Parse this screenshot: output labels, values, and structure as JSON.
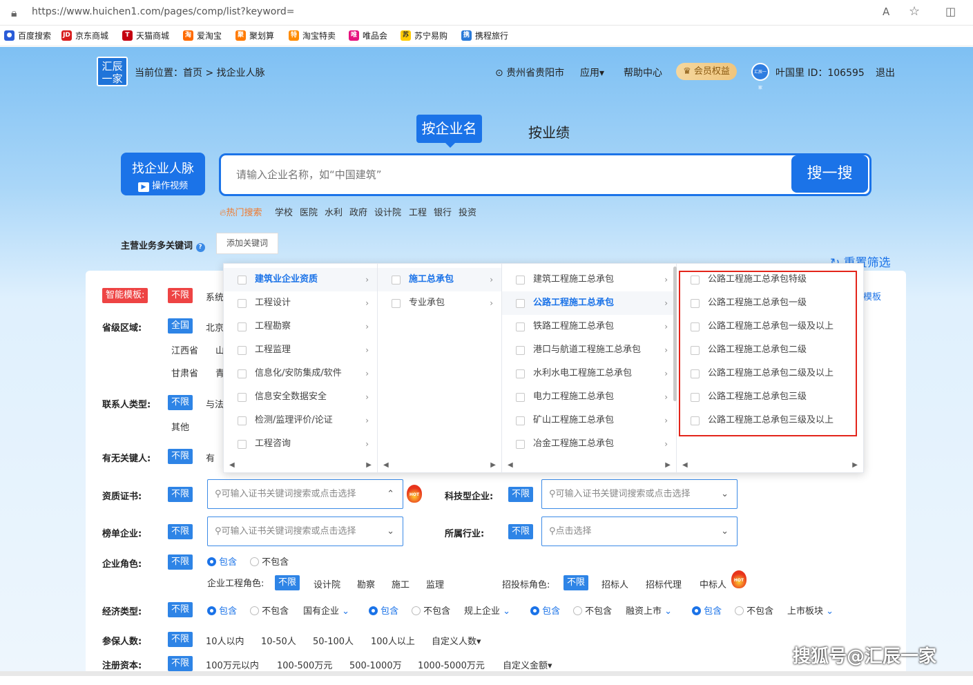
{
  "browser": {
    "url": "https://www.huichen1.com/pages/comp/list?keyword=",
    "read_icon": "A̅",
    "star_icon": "☆"
  },
  "bookmarks": [
    "百度搜索",
    "京东商城",
    "天猫商城",
    "爱淘宝",
    "聚划算",
    "淘宝特卖",
    "唯品会",
    "苏宁易购",
    "携程旅行"
  ],
  "header": {
    "logo_line1": "汇辰",
    "logo_line2": "一家",
    "breadcrumb": "当前位置：首页 > 找企业人脉",
    "location": "贵州省贵阳市",
    "apps": "应用▾",
    "help": "帮助中心",
    "vip": "会员权益",
    "user": "叶国里 ID：106595",
    "logout": "退出",
    "avatar_text": "汇辰一家"
  },
  "tabs": {
    "by_name": "按企业名",
    "by_perf": "按业绩"
  },
  "find": {
    "title": "找企业人脉",
    "video": "操作视频"
  },
  "search": {
    "placeholder": "请输入企业名称，如“中国建筑”",
    "button": "搜一搜"
  },
  "hot": {
    "label": "热门搜索",
    "items": [
      "学校",
      "医院",
      "水利",
      "政府",
      "设计院",
      "工程",
      "银行",
      "投资"
    ]
  },
  "keyword": {
    "label": "主营业务多关键词",
    "button": "添加关键词"
  },
  "reset": "重置筛选",
  "filters": {
    "template_label": "智能模板:",
    "template_value": "不限",
    "template_sys": "系统",
    "template_right": "模板",
    "region_label": "省级区域:",
    "region_all": "全国",
    "region_1": "北京",
    "region_2": "江西省",
    "region_3": "山",
    "region_4": "甘肃省",
    "region_5": "青",
    "contact_label": "联系人类型:",
    "contact_all": "不限",
    "contact_1": "与法",
    "contact_2": "其他",
    "keyperson_label": "有无关键人:",
    "keyperson_all": "不限",
    "keyperson_1": "有",
    "cert_label": "资质证书:",
    "cert_all": "不限",
    "cert_placeholder": "可输入证书关键词搜索或点击选择",
    "tech_label": "科技型企业:",
    "tech_all": "不限",
    "tech_placeholder": "可输入证书关键词搜索或点击选择",
    "rank_label": "榜单企业:",
    "rank_all": "不限",
    "rank_placeholder": "可输入证书关键词搜索或点击选择",
    "industry_label": "所属行业:",
    "industry_all": "不限",
    "industry_placeholder": "点击选择",
    "role_label": "企业角色:",
    "role_all": "不限",
    "include": "包含",
    "exclude": "不包含",
    "eng_role_label": "企业工程角色:",
    "eng_role_all": "不限",
    "eng_roles": [
      "设计院",
      "勘察",
      "施工",
      "监理"
    ],
    "bid_role_label": "招投标角色:",
    "bid_role_all": "不限",
    "bid_roles": [
      "招标人",
      "招标代理",
      "中标人"
    ],
    "econ_label": "经济类型:",
    "econ_all": "不限",
    "econ_groups": [
      "国有企业",
      "规上企业",
      "融资上市",
      "上市板块"
    ],
    "insured_label": "参保人数:",
    "insured_all": "不限",
    "insured_opts": [
      "10人以内",
      "10-50人",
      "50-100人",
      "100人以上",
      "自定义人数▾"
    ],
    "capital_label": "注册资本:",
    "capital_all": "不限",
    "capital_opts": [
      "100万元以内",
      "100-500万元",
      "500-1000万",
      "1000-5000万元",
      "自定义金额▾"
    ],
    "hot_badge": "HOT"
  },
  "dropdown": {
    "col1": [
      {
        "label": "建筑业企业资质",
        "active": true
      },
      {
        "label": "工程设计"
      },
      {
        "label": "工程勘察"
      },
      {
        "label": "工程监理"
      },
      {
        "label": "信息化/安防集成/软件"
      },
      {
        "label": "信息安全数据安全"
      },
      {
        "label": "检测/监理评价/论证"
      },
      {
        "label": "工程咨询"
      }
    ],
    "col2": [
      {
        "label": "施工总承包",
        "active": true
      },
      {
        "label": "专业承包"
      }
    ],
    "col3": [
      {
        "label": "建筑工程施工总承包"
      },
      {
        "label": "公路工程施工总承包",
        "active": true
      },
      {
        "label": "铁路工程施工总承包"
      },
      {
        "label": "港口与航道工程施工总承包"
      },
      {
        "label": "水利水电工程施工总承包"
      },
      {
        "label": "电力工程施工总承包"
      },
      {
        "label": "矿山工程施工总承包"
      },
      {
        "label": "冶金工程施工总承包"
      }
    ],
    "col4": [
      {
        "label": "公路工程施工总承包特级"
      },
      {
        "label": "公路工程施工总承包一级"
      },
      {
        "label": "公路工程施工总承包一级及以上"
      },
      {
        "label": "公路工程施工总承包二级"
      },
      {
        "label": "公路工程施工总承包二级及以上"
      },
      {
        "label": "公路工程施工总承包三级"
      },
      {
        "label": "公路工程施工总承包三级及以上"
      }
    ]
  },
  "watermark": "搜狐号@汇辰一家"
}
